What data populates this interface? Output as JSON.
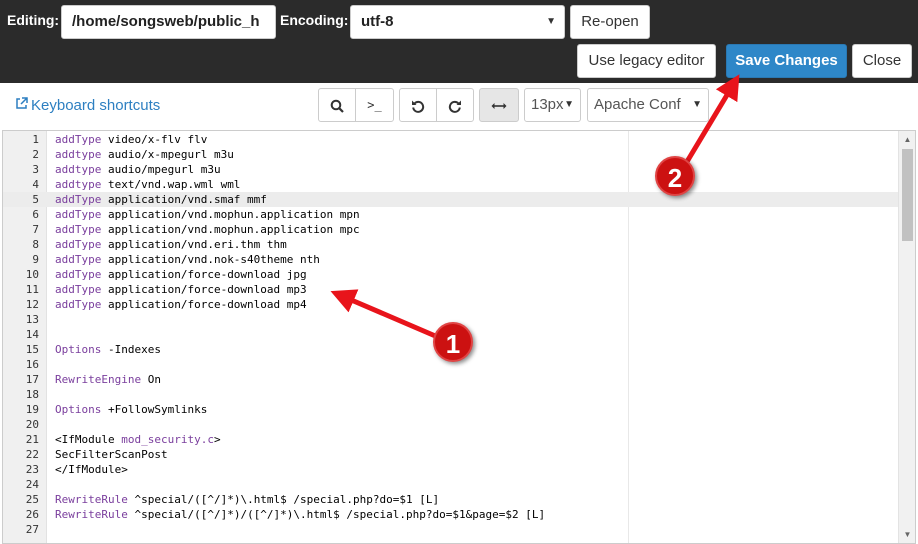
{
  "header": {
    "editing_label": "Editing:",
    "file_path": "/home/songsweb/public_h",
    "encoding_label": "Encoding:",
    "encoding_value": "utf-8",
    "reopen_label": "Re-open",
    "legacy_editor_label": "Use legacy editor",
    "save_label": "Save Changes",
    "close_label": "Close"
  },
  "toolbar": {
    "shortcuts_label": "Keyboard shortcuts",
    "search_icon": "search-icon",
    "goto_icon": ">_",
    "undo_icon": "undo-icon",
    "redo_icon": "redo-icon",
    "wrap_icon": "wrap-icon",
    "font_size": "13px",
    "mode": "Apache Conf"
  },
  "editor": {
    "active_line": 5,
    "lines": [
      {
        "n": "1",
        "kw": "addType",
        "rest": " video/x-flv flv"
      },
      {
        "n": "2",
        "kw": "addtype",
        "rest": " audio/x-mpegurl m3u"
      },
      {
        "n": "3",
        "kw": "addtype",
        "rest": " audio/mpegurl m3u"
      },
      {
        "n": "4",
        "kw": "addtype",
        "rest": " text/vnd.wap.wml wml"
      },
      {
        "n": "5",
        "kw": "addType",
        "rest": " application/vnd.smaf mmf"
      },
      {
        "n": "6",
        "kw": "addType",
        "rest": " application/vnd.mophun.application mpn"
      },
      {
        "n": "7",
        "kw": "addType",
        "rest": " application/vnd.mophun.application mpc"
      },
      {
        "n": "8",
        "kw": "addType",
        "rest": " application/vnd.eri.thm thm"
      },
      {
        "n": "9",
        "kw": "addType",
        "rest": " application/vnd.nok-s40theme nth"
      },
      {
        "n": "10",
        "kw": "addType",
        "rest": " application/force-download jpg"
      },
      {
        "n": "11",
        "kw": "addType",
        "rest": " application/force-download mp3"
      },
      {
        "n": "12",
        "kw": "addType",
        "rest": " application/force-download mp4"
      },
      {
        "n": "13",
        "kw": "",
        "rest": ""
      },
      {
        "n": "14",
        "kw": "",
        "rest": ""
      },
      {
        "n": "15",
        "kw": "Options",
        "rest": " -Indexes"
      },
      {
        "n": "16",
        "kw": "",
        "rest": ""
      },
      {
        "n": "17",
        "kw": "RewriteEngine",
        "rest": " On"
      },
      {
        "n": "18",
        "kw": "",
        "rest": ""
      },
      {
        "n": "19",
        "kw": "Options",
        "rest": " +FollowSymlinks"
      },
      {
        "n": "20",
        "kw": "",
        "rest": ""
      },
      {
        "n": "21",
        "kw": "",
        "rest": "<IfModule ",
        "kw2": "mod_security.c",
        "rest2": ">"
      },
      {
        "n": "22",
        "kw": "",
        "rest": "SecFilterScanPost"
      },
      {
        "n": "23",
        "kw": "",
        "rest": "</IfModule>"
      },
      {
        "n": "24",
        "kw": "",
        "rest": ""
      },
      {
        "n": "25",
        "kw": "RewriteRule",
        "rest": " ^special/([^/]*)\\.html$ /special.php?do=$1 [L]"
      },
      {
        "n": "26",
        "kw": "RewriteRule",
        "rest": " ^special/([^/]*)/([^/]*)\\.html$ /special.php?do=$1&page=$2 [L]"
      },
      {
        "n": "27",
        "kw": "",
        "rest": ""
      }
    ]
  },
  "annotations": {
    "badge_1": "1",
    "badge_2": "2",
    "arrow_color": "#e8141b"
  }
}
